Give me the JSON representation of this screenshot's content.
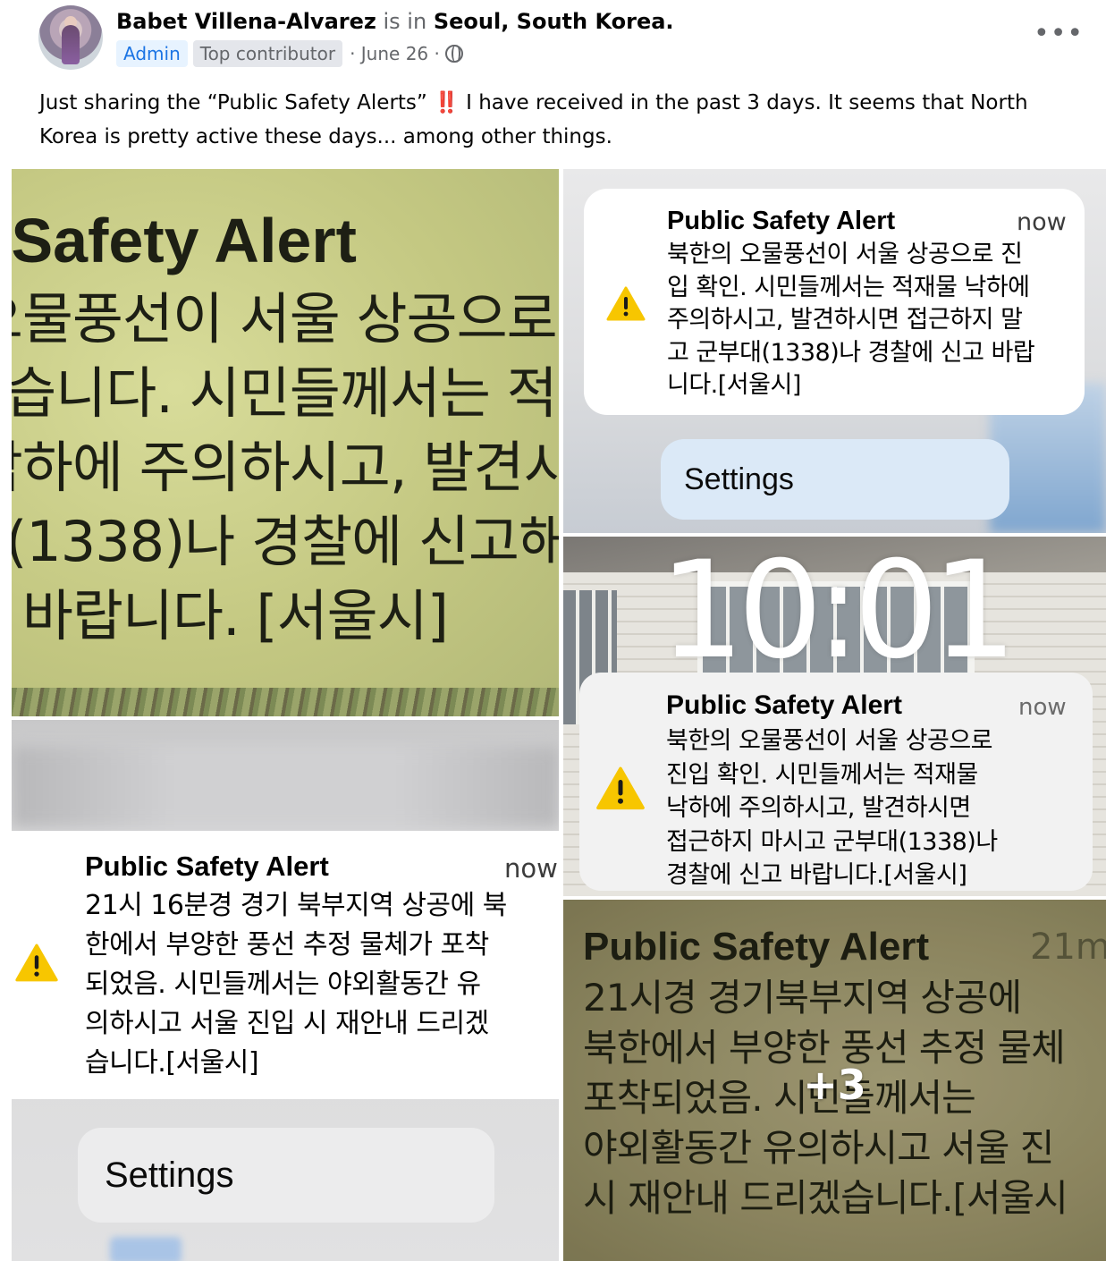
{
  "post": {
    "author": "Babet Villena-Alvarez",
    "is_in": "is in",
    "location": "Seoul, South Korea.",
    "badges": [
      "Admin",
      "Top contributor"
    ],
    "date": "· June 26 ·",
    "text_before": "Just sharing the “Public Safety Alerts” ",
    "emoji": "‼️",
    "text_after": " I have received in the past 3 days. It seems that North Korea is pretty active these days... among other things."
  },
  "photos": {
    "tile1": {
      "title": "Public Safety Alert",
      "body": "북한 오물풍선이 서울 상공으로 진\n입되었습니다. 시민들께서는 적\n재물 낙하에 주의하시고, 발견시\n군부대(1338)나 경찰에 신고해\n주시기 바랍니다. [서울시]"
    },
    "tile2": {
      "notif_title": "Public Safety Alert",
      "notif_time": "now",
      "notif_body": "북한의 오물풍선이 서울 상공으로 진\n입 확인. 시민들께서는 적재물 낙하에\n주의하시고, 발견하시면 접근하지 말\n고 군부대(1338)나 경찰에 신고 바랍\n니다.[서울시]",
      "settings_label": "Settings"
    },
    "tile3": {
      "notif_title": "Public Safety Alert",
      "notif_time": "now",
      "notif_body": "21시 16분경 경기 북부지역 상공에 북\n한에서 부양한 풍선 추정 물체가 포착\n되었음. 시민들께서는 야외활동간 유\n의하시고 서울 진입 시 재안내 드리겠\n습니다.[서울시]",
      "settings_label": "Settings"
    },
    "tile4": {
      "clock": "10:01",
      "notif_title": "Public Safety Alert",
      "notif_time": "now",
      "notif_body": "북한의 오물풍선이 서울 상공으로\n진입 확인. 시민들께서는 적재물\n낙하에 주의하시고, 발견하시면\n접근하지 마시고 군부대(1338)나\n경찰에 신고 바랍니다.[서울시]"
    },
    "tile5": {
      "title": "Public Safety Alert",
      "time": "21m",
      "body": "21시경 경기북부지역 상공에\n북한에서 부양한 풍선 추정 물체\n포착되었음. 시민들께서는\n야외활동간 유의하시고 서울 진\n시 재안내 드리겠습니다.[서울시",
      "more_count": "+3"
    }
  },
  "icons": {
    "more": "more-horizontal-icon",
    "audience": "globe-icon",
    "alert": "warning-triangle-icon"
  },
  "colors": {
    "admin_badge_text": "#1b74e4",
    "admin_badge_bg": "#e7f3ff",
    "muted_text": "#65676b",
    "warning_yellow": "#f7c600"
  }
}
